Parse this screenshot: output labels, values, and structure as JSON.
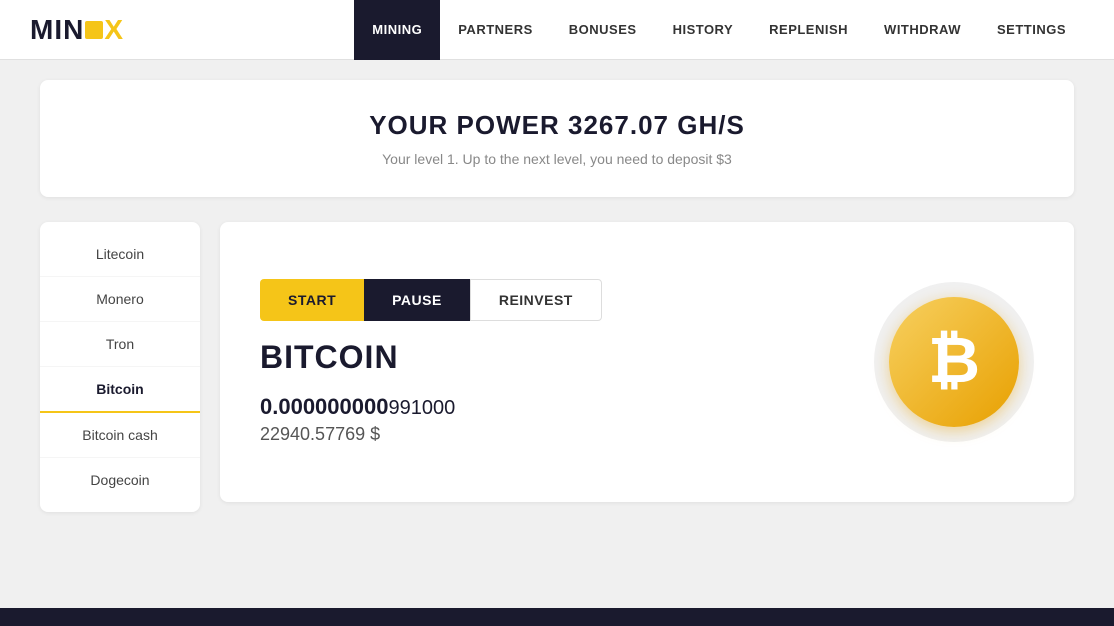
{
  "app": {
    "logo": {
      "text_min": "MIN",
      "text_ex": "EX"
    }
  },
  "navbar": {
    "items": [
      {
        "id": "mining",
        "label": "MINING",
        "active": true
      },
      {
        "id": "partners",
        "label": "PARTNERS",
        "active": false
      },
      {
        "id": "bonuses",
        "label": "BONUSES",
        "active": false
      },
      {
        "id": "history",
        "label": "HISTORY",
        "active": false
      },
      {
        "id": "replenish",
        "label": "REPLENISH",
        "active": false
      },
      {
        "id": "withdraw",
        "label": "WITHDRAW",
        "active": false
      },
      {
        "id": "settings",
        "label": "SETTINGS",
        "active": false
      }
    ]
  },
  "power_card": {
    "title": "YOUR POWER 3267.07 GH/S",
    "subtitle": "Your level 1. Up to the next level, you need to deposit $3"
  },
  "coin_list": {
    "items": [
      {
        "id": "litecoin",
        "label": "Litecoin",
        "active": false
      },
      {
        "id": "monero",
        "label": "Monero",
        "active": false
      },
      {
        "id": "tron",
        "label": "Tron",
        "active": false
      },
      {
        "id": "bitcoin",
        "label": "Bitcoin",
        "active": true
      },
      {
        "id": "bitcoin-cash",
        "label": "Bitcoin cash",
        "active": false
      },
      {
        "id": "dogecoin",
        "label": "Dogecoin",
        "active": false
      }
    ]
  },
  "mining_card": {
    "buttons": {
      "start": "START",
      "pause": "PAUSE",
      "reinvest": "REINVEST"
    },
    "coin_name": "BITCOIN",
    "balance_bold": "0.000000000",
    "balance_light": "991000",
    "balance_usd": "22940.57769 $",
    "btc_symbol": "₿"
  }
}
